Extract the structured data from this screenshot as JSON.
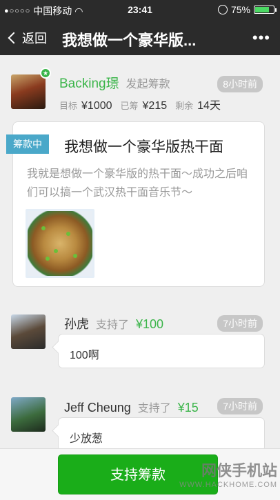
{
  "status_bar": {
    "signal": "●○○○○",
    "carrier": "中国移动",
    "time": "23:41",
    "battery_percent": "75%",
    "battery_level": 0.75
  },
  "nav": {
    "back_label": "返回",
    "title": "我想做一个豪华版...",
    "more_label": "•••"
  },
  "initiator": {
    "name": "Backing璟",
    "action": "发起筹款",
    "time_ago": "8小时前",
    "target_label": "目标",
    "target_value": "¥1000",
    "raised_label": "已筹",
    "raised_value": "¥215",
    "remaining_label": "剩余",
    "remaining_value": "14天"
  },
  "project": {
    "status_tag": "筹款中",
    "title": "我想做一个豪华版热干面",
    "description": "我就是想做一个豪华版的热干面～成功之后咱们可以搞一个武汉热干面音乐节～"
  },
  "supporters": [
    {
      "name": "孙虎",
      "verb": "支持了",
      "amount": "¥100",
      "time_ago": "7小时前",
      "message": "100啊"
    },
    {
      "name": "Jeff Cheung",
      "verb": "支持了",
      "amount": "¥15",
      "time_ago": "7小时前",
      "message": "少放葱"
    }
  ],
  "bottom": {
    "button_label": "支持筹款",
    "watermark_text": "网侠手机站",
    "watermark_url": "WWW.HACKHOME.COM"
  }
}
